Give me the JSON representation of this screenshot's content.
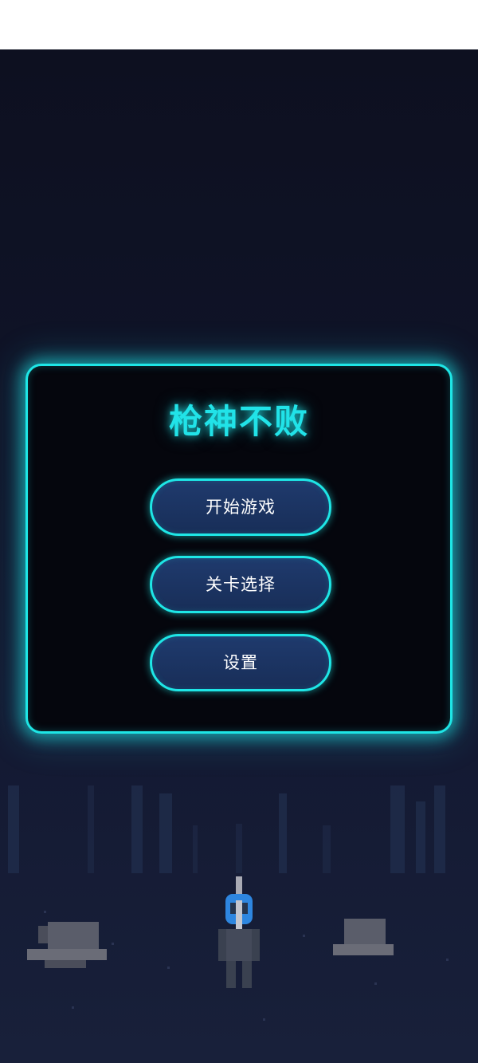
{
  "game": {
    "title": "枪神不败"
  },
  "menu": {
    "start_label": "开始游戏",
    "level_select_label": "关卡选择",
    "settings_label": "设置"
  },
  "colors": {
    "accent": "#1ee6e6",
    "title": "#21e3e8",
    "button_fill": "#1f3a6d",
    "panel_bg": "#05060d",
    "background": "#101429"
  }
}
